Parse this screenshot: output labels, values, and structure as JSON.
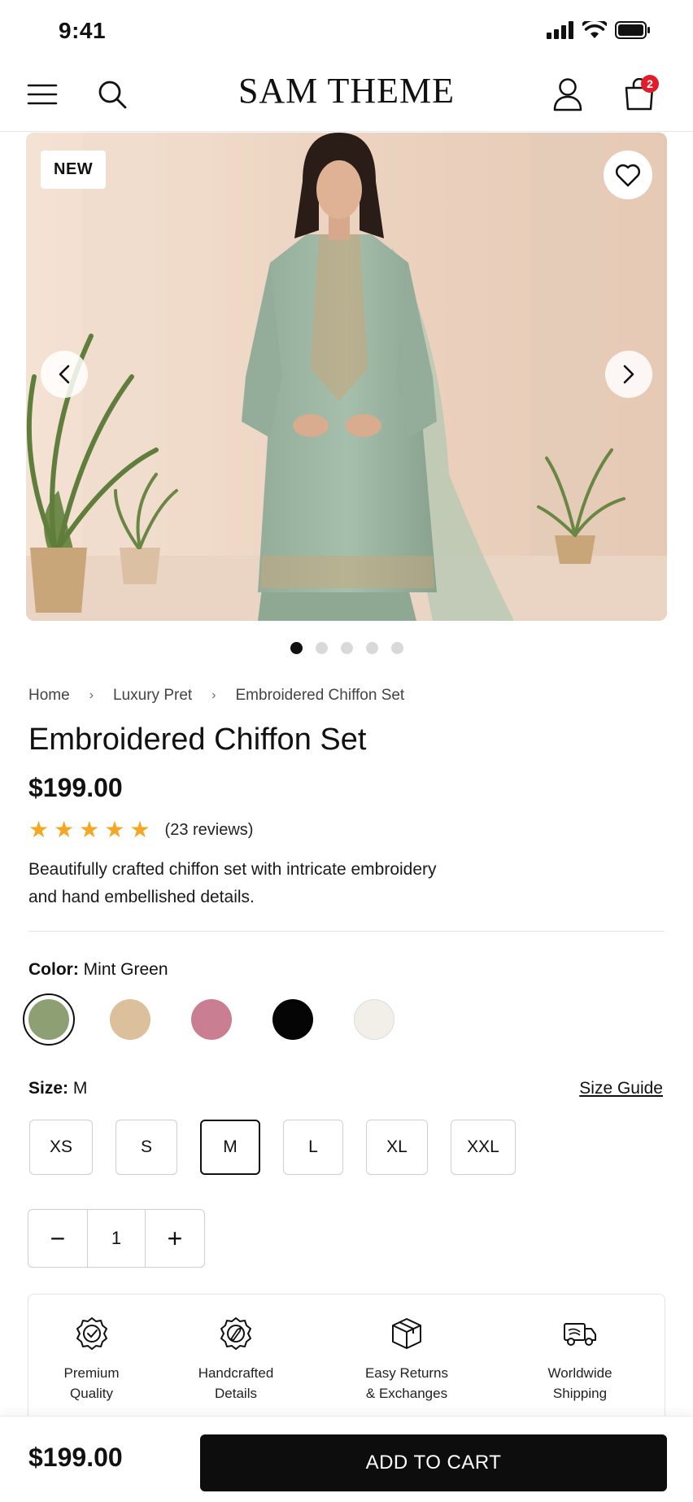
{
  "status": {
    "time": "9:41"
  },
  "header": {
    "brand": "SAM THEME",
    "cart_count": "2"
  },
  "gallery": {
    "badge": "NEW",
    "total_images": 5,
    "active_index": 0
  },
  "breadcrumb": [
    "Home",
    "Luxury Pret",
    "Embroidered Chiffon Set"
  ],
  "product": {
    "title": "Embroidered Chiffon Set",
    "price": "$199.00",
    "rating": 5,
    "reviews": "(23 reviews)",
    "description": "Beautifully crafted chiffon set with intricate embroidery and hand embellished details."
  },
  "color": {
    "label": "Color:",
    "value": "Mint Green",
    "swatches": [
      "#8e9f74",
      "#dcbf9b",
      "#c97e92",
      "#050505",
      "#f2efe9"
    ],
    "selected_index": 0
  },
  "size": {
    "label": "Size:",
    "value": "M",
    "guide": "Size Guide",
    "options": [
      "XS",
      "S",
      "M",
      "L",
      "XL",
      "XXL"
    ],
    "selected_index": 2
  },
  "quantity": {
    "minus": "−",
    "value": "1",
    "plus": "+"
  },
  "features": [
    {
      "icon": "premium-quality-icon",
      "line1": "Premium",
      "line2": "Quality"
    },
    {
      "icon": "handcrafted-icon",
      "line1": "Handcrafted",
      "line2": "Details"
    },
    {
      "icon": "returns-box-icon",
      "line1": "Easy Returns",
      "line2": "& Exchanges"
    },
    {
      "icon": "shipping-truck-icon",
      "line1": "Worldwide",
      "line2": "Shipping"
    }
  ],
  "bottom": {
    "price": "$199.00",
    "cta": "ADD TO CART"
  },
  "colors": {
    "accent": "#0d0d0d",
    "star": "#f5a623",
    "badge": "#e11d2a"
  }
}
